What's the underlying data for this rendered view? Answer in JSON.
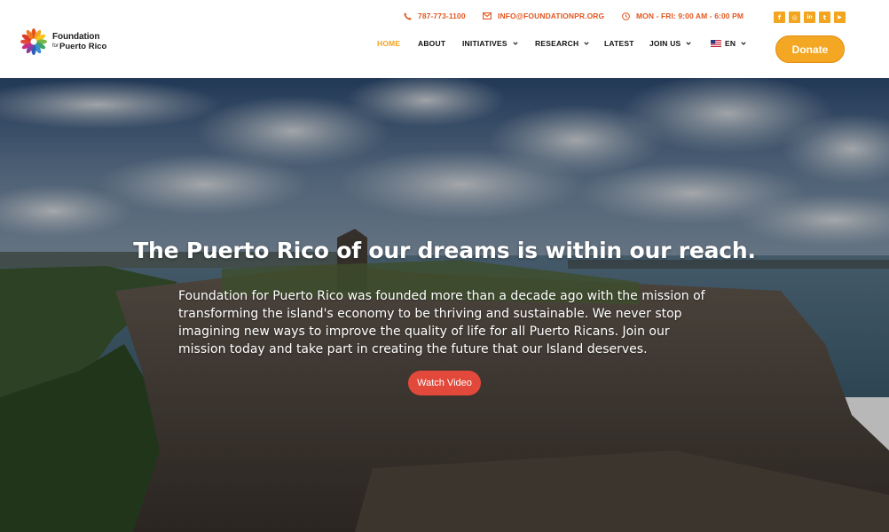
{
  "brand": {
    "name_line1": "Foundation",
    "name_line2_small": "for",
    "name_line2": "Puerto Rico",
    "logo_colors": [
      "#e3571f",
      "#f3a722",
      "#3a8fd1",
      "#7ab648",
      "#8a3fa0",
      "#e2493a"
    ]
  },
  "topbar": {
    "phone": "787-773-1100",
    "phone_icon": "phone-icon",
    "email": "INFO@FOUNDATIONPR.ORG",
    "email_icon": "envelope-icon",
    "hours": "MON - FRI: 9:00 AM - 6:00 PM",
    "hours_icon": "clock-icon",
    "accent": "#e3571f"
  },
  "social": [
    {
      "name": "facebook-icon",
      "glyph": "f"
    },
    {
      "name": "instagram-icon",
      "glyph": "◎"
    },
    {
      "name": "linkedin-icon",
      "glyph": "in"
    },
    {
      "name": "twitter-icon",
      "glyph": "t"
    },
    {
      "name": "youtube-icon",
      "glyph": "▶"
    }
  ],
  "nav": {
    "items": [
      {
        "label": "HOME",
        "active": true
      },
      {
        "label": "ABOUT"
      },
      {
        "label": "INITIATIVES",
        "dropdown": true
      },
      {
        "label": "RESEARCH",
        "dropdown": true
      },
      {
        "label": "LATEST"
      },
      {
        "label": "JOIN US",
        "dropdown": true
      },
      {
        "label": "EN",
        "dropdown": true,
        "flag": "us-flag-icon"
      }
    ],
    "active_color": "#f0a325"
  },
  "donate": {
    "label": "Donate",
    "color": "#f3a722"
  },
  "hero": {
    "title": "The Puerto Rico of our dreams is within our reach.",
    "text": "Foundation for Puerto Rico was founded more than a decade ago with the mission of transforming the island's economy to be thriving and sustainable. We never stop imagining new ways to improve the quality of life for all Puerto Ricans. Join our mission today and take part in creating the future that our Island deserves.",
    "button": "Watch Video",
    "button_color": "#e2493a"
  }
}
